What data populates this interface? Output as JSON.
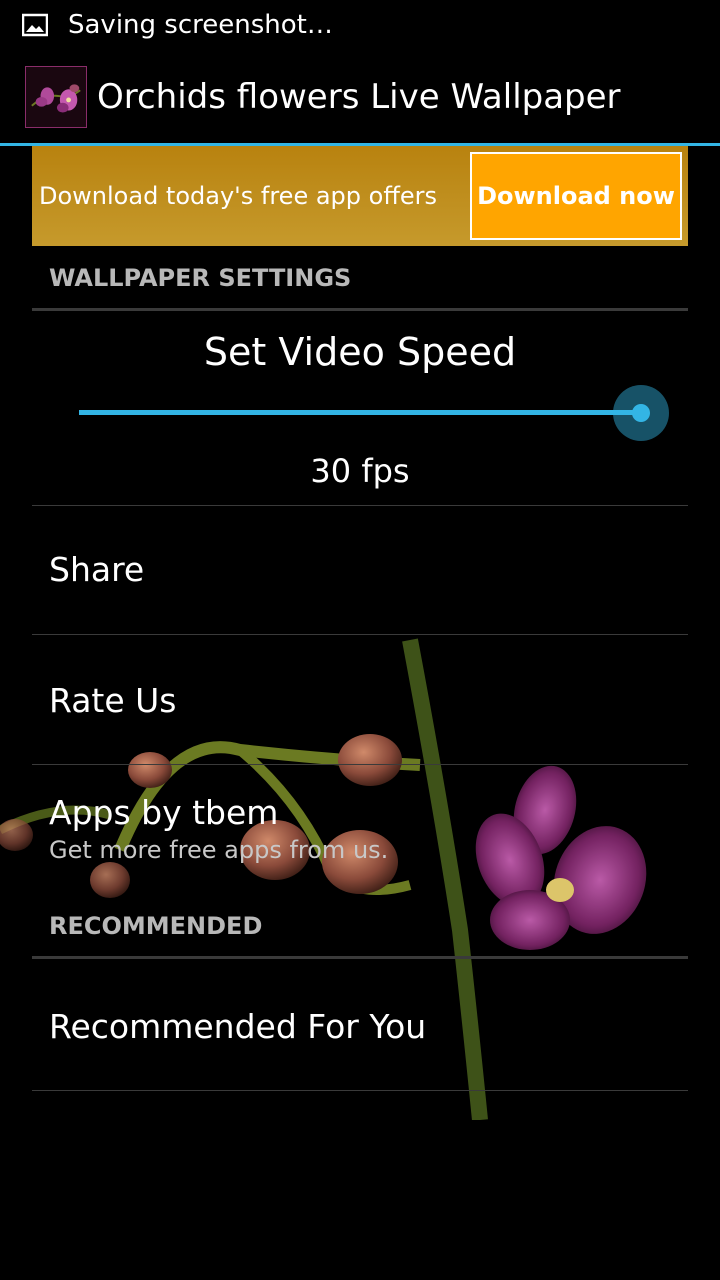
{
  "status_bar": {
    "notification_icon": "image-icon",
    "text": "Saving screenshot…"
  },
  "action_bar": {
    "app_icon": "orchid-app-icon",
    "title": "Orchids flowers Live Wallpaper",
    "accent_color": "#33b5e5"
  },
  "ad": {
    "text": "Download today's free app offers",
    "button_label": "Download now",
    "banner_color": "#b8820f",
    "button_color": "#ffa500"
  },
  "wallpaper_settings": {
    "header": "WALLPAPER SETTINGS",
    "video_speed": {
      "title": "Set Video Speed",
      "value_label": "30 fps",
      "slider_fraction": 1.0
    },
    "share": {
      "title": "Share"
    },
    "rate": {
      "title": "Rate Us"
    },
    "apps": {
      "title": "Apps by tbem",
      "summary": "Get more free apps from us."
    }
  },
  "recommended": {
    "header": "RECOMMENDED",
    "item": {
      "title": "Recommended For You"
    }
  }
}
